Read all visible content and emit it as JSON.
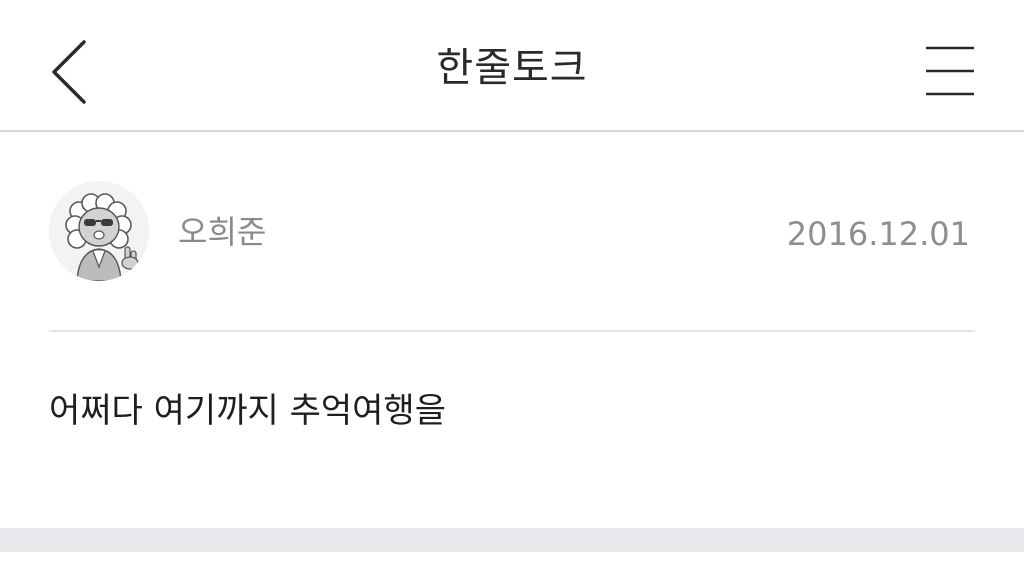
{
  "navbar": {
    "title": "한줄토크",
    "back_icon": "chevron-left-icon",
    "menu_icon": "hamburger-menu-icon"
  },
  "post": {
    "author": "오희준",
    "date": "2016.12.01",
    "content": "어쩌다 여기까지 추억여행을",
    "avatar_icon": "user-avatar-character"
  },
  "colors": {
    "background": "#ffffff",
    "divider": "#d6d6d6",
    "muted_text": "#8a8a8a",
    "body_text": "#1e1e1e",
    "footer_band": "#e8e7ec"
  }
}
